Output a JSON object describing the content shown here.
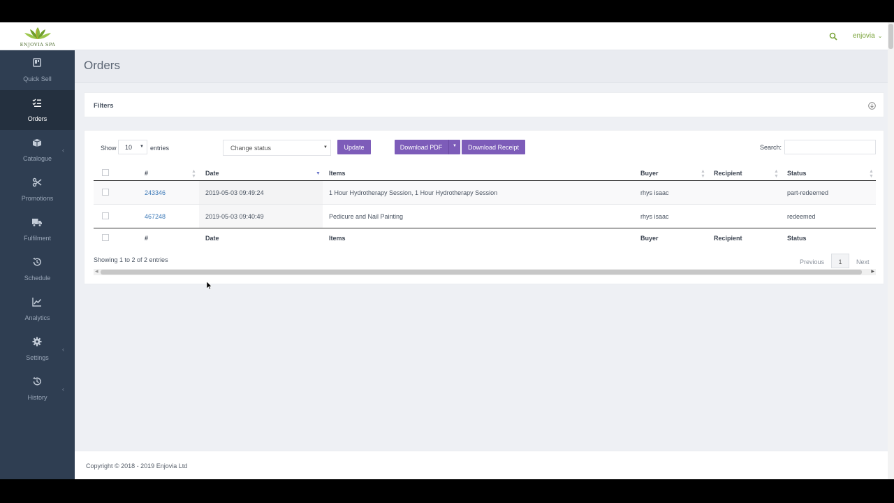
{
  "brand": {
    "logo_text": "ENJOVIA SPA"
  },
  "topbar": {
    "user": "enjovia",
    "search_icon": "search-icon",
    "user_menu_icon": "chevron-down-icon"
  },
  "sidebar": {
    "items": [
      {
        "label": "Quick Sell",
        "icon": "quick-sell-icon",
        "active": false
      },
      {
        "label": "Orders",
        "icon": "orders-list-icon",
        "active": true
      },
      {
        "label": "Catalogue",
        "icon": "box-icon",
        "active": false,
        "has_submenu": true
      },
      {
        "label": "Promotions",
        "icon": "scissors-icon",
        "active": false
      },
      {
        "label": "Fulfilment",
        "icon": "truck-icon",
        "active": false
      },
      {
        "label": "Schedule",
        "icon": "history-icon",
        "active": false
      },
      {
        "label": "Analytics",
        "icon": "line-chart-icon",
        "active": false
      },
      {
        "label": "Settings",
        "icon": "gear-icon",
        "active": false,
        "has_submenu": true
      },
      {
        "label": "History",
        "icon": "history-icon",
        "active": false,
        "has_submenu": true
      }
    ]
  },
  "page": {
    "title": "Orders"
  },
  "filters": {
    "title": "Filters"
  },
  "controls": {
    "show_label": "Show",
    "page_size": "10",
    "entries_label": "entries",
    "status_select": "Change status",
    "update_label": "Update",
    "download_pdf_label": "Download PDF",
    "download_receipt_label": "Download Receipt",
    "search_label": "Search:",
    "search_value": ""
  },
  "table": {
    "columns": [
      "#",
      "Date",
      "Items",
      "Buyer",
      "Recipient",
      "Status"
    ],
    "sorted_column": "Date",
    "rows": [
      {
        "id": "243346",
        "date": "2019-05-03 09:49:24",
        "items": "1 Hour Hydrotherapy Session, 1 Hour Hydrotherapy Session",
        "buyer": "rhys isaac",
        "recipient": "",
        "status": "part-redeemed"
      },
      {
        "id": "467248",
        "date": "2019-05-03 09:40:49",
        "items": "Pedicure and Nail Painting",
        "buyer": "rhys isaac",
        "recipient": "",
        "status": "redeemed"
      }
    ]
  },
  "pagination": {
    "info": "Showing 1 to 2 of 2 entries",
    "previous": "Previous",
    "current": "1",
    "next": "Next"
  },
  "footer": {
    "copyright": "Copyright © 2018 - 2019 Enjovia Ltd"
  },
  "colors": {
    "sidebar": "#2f3e52",
    "accent_button": "#7d5cb9",
    "link": "#3d7ab8",
    "brand_green": "#7aa33a"
  }
}
